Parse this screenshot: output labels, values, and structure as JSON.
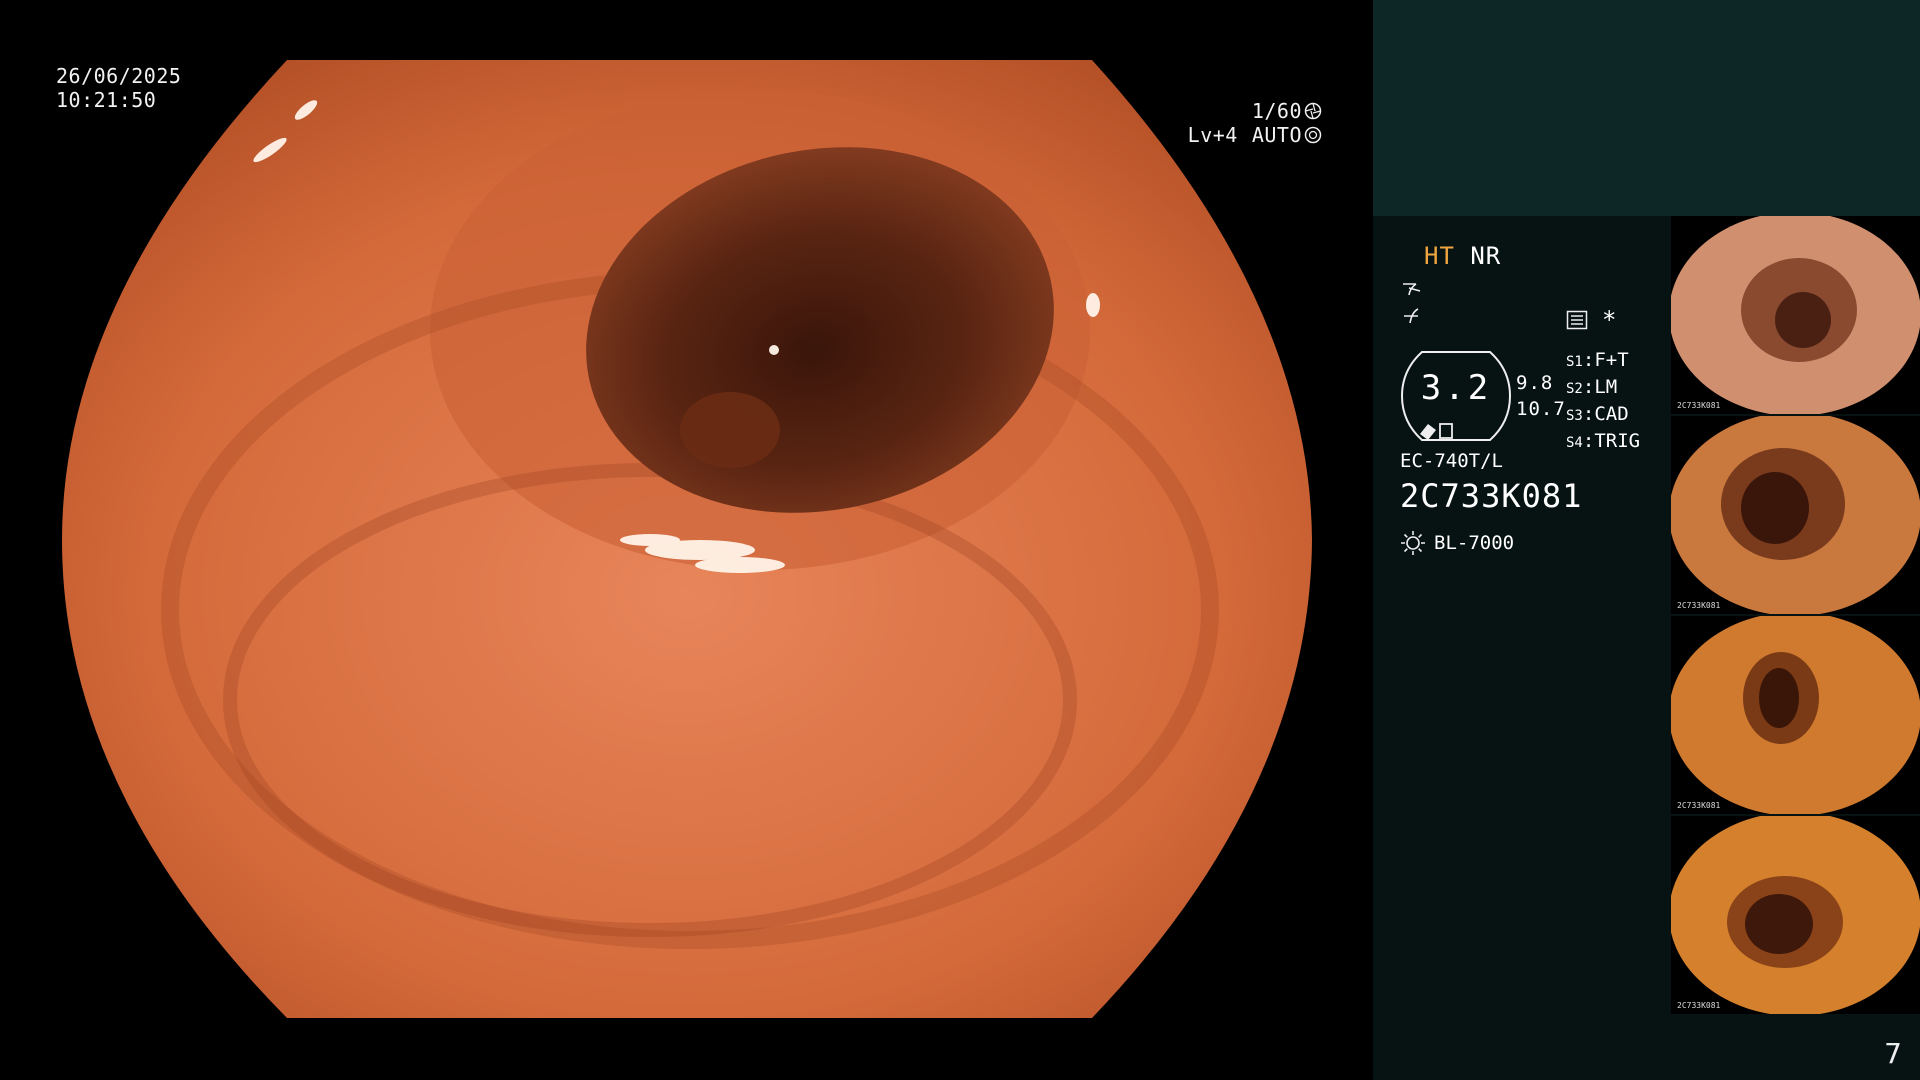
{
  "scope": {
    "date": "26/06/2025",
    "time": "10:21:50",
    "shutter": "1/60",
    "level": "Lv+4",
    "iris": "AUTO"
  },
  "info": {
    "mode_ht": "HT",
    "mode_nr": "NR",
    "box_value": "3.2",
    "side_value_1": "9.8",
    "side_value_2": "10.7",
    "switches": [
      {
        "key": "S1",
        "value": "F+T"
      },
      {
        "key": "S2",
        "value": "LM"
      },
      {
        "key": "S3",
        "value": "CAD"
      },
      {
        "key": "S4",
        "value": "TRIG"
      }
    ],
    "asterisk": "*",
    "model": "EC-740T/L",
    "serial": "2C733K081",
    "lamp": "BL-7000"
  },
  "thumbnails": [
    {
      "caption": "2C733K081"
    },
    {
      "caption": "2C733K081"
    },
    {
      "caption": "2C733K081"
    },
    {
      "caption": "2C733K081"
    }
  ],
  "page_number": "7",
  "colors": {
    "mucosa": "#d9703e",
    "lumen": "#4a1d10",
    "side_top": "#0d2727",
    "side_bottom": "#071313",
    "ht_accent": "#f0a640"
  }
}
